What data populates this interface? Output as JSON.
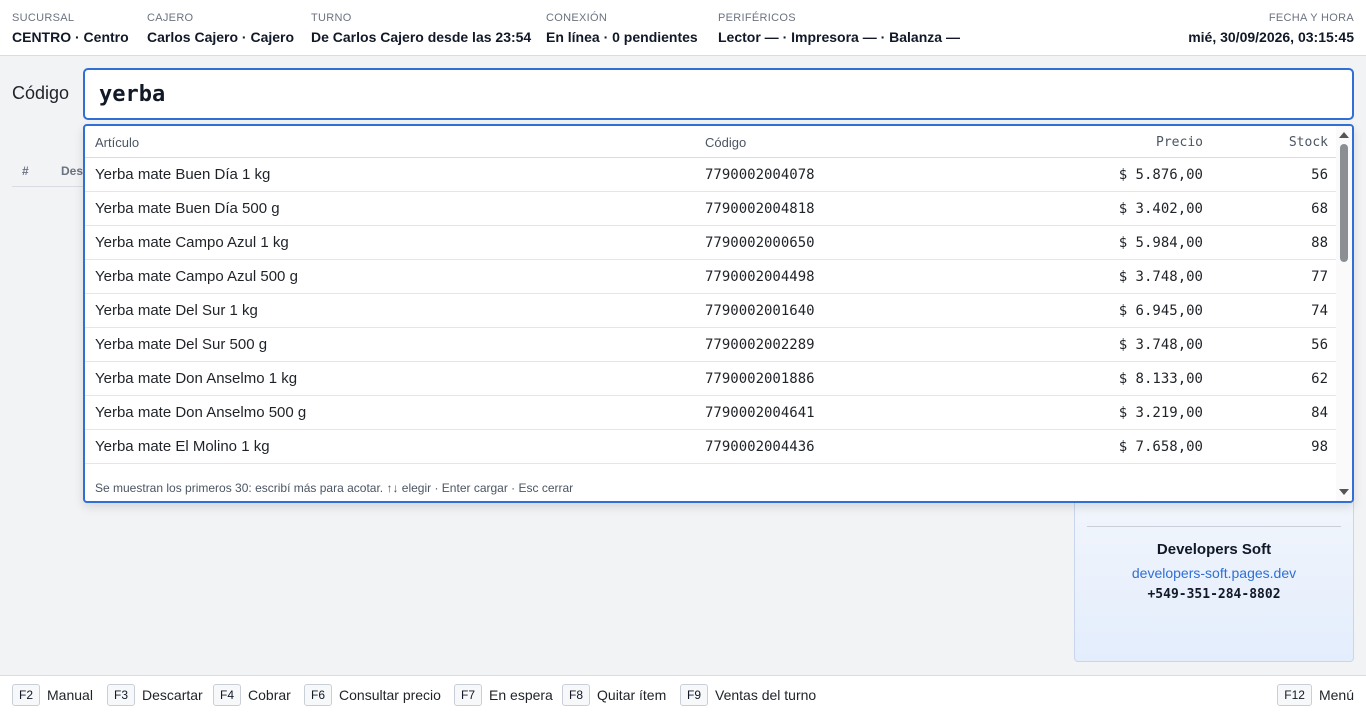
{
  "status_bar": {
    "branch": {
      "label": "SUCURSAL",
      "value": "CENTRO · Centro"
    },
    "cashier": {
      "label": "CAJERO",
      "value": "Carlos Cajero · Cajero"
    },
    "shift": {
      "label": "TURNO",
      "value": "De Carlos Cajero desde las 23:54"
    },
    "connection": {
      "label": "CONEXIÓN",
      "value": "En línea · 0 pendientes"
    },
    "peripherals": {
      "label": "PERIFÉRICOS",
      "value": "Lector — · Impresora — · Balanza —"
    },
    "datetime": {
      "label": "FECHA Y HORA",
      "value": "mié, 30/09/2026, 03:15:45"
    }
  },
  "code_entry": {
    "label": "Código",
    "value": "yerba"
  },
  "cart_table": {
    "col_index": "#",
    "col_desc": "Des"
  },
  "search_results": {
    "headers": {
      "name": "Artículo",
      "code": "Código",
      "price": "Precio",
      "stock": "Stock"
    },
    "rows": [
      {
        "name": "Yerba mate Buen Día 1 kg",
        "code": "7790002004078",
        "price": "$ 5.876,00",
        "stock": "56"
      },
      {
        "name": "Yerba mate Buen Día 500 g",
        "code": "7790002004818",
        "price": "$ 3.402,00",
        "stock": "68"
      },
      {
        "name": "Yerba mate Campo Azul 1 kg",
        "code": "7790002000650",
        "price": "$ 5.984,00",
        "stock": "88"
      },
      {
        "name": "Yerba mate Campo Azul 500 g",
        "code": "7790002004498",
        "price": "$ 3.748,00",
        "stock": "77"
      },
      {
        "name": "Yerba mate Del Sur 1 kg",
        "code": "7790002001640",
        "price": "$ 6.945,00",
        "stock": "74"
      },
      {
        "name": "Yerba mate Del Sur 500 g",
        "code": "7790002002289",
        "price": "$ 3.748,00",
        "stock": "56"
      },
      {
        "name": "Yerba mate Don Anselmo 1 kg",
        "code": "7790002001886",
        "price": "$ 8.133,00",
        "stock": "62"
      },
      {
        "name": "Yerba mate Don Anselmo 500 g",
        "code": "7790002004641",
        "price": "$ 3.219,00",
        "stock": "84"
      },
      {
        "name": "Yerba mate El Molino 1 kg",
        "code": "7790002004436",
        "price": "$ 7.658,00",
        "stock": "98"
      }
    ],
    "footer": "Se muestran los primeros 30: escribí más para acotar. ↑↓ elegir · Enter cargar · Esc cerrar"
  },
  "side_panel": {
    "brand": "Developers Soft",
    "website": "developers-soft.pages.dev",
    "phone": "+549-351-284-8802"
  },
  "function_keys": [
    {
      "key": "F2",
      "label": "Manual"
    },
    {
      "key": "F3",
      "label": "Descartar"
    },
    {
      "key": "F4",
      "label": "Cobrar"
    },
    {
      "key": "F6",
      "label": "Consultar precio"
    },
    {
      "key": "F7",
      "label": "En espera"
    },
    {
      "key": "F8",
      "label": "Quitar ítem"
    },
    {
      "key": "F9",
      "label": "Ventas del turno"
    },
    {
      "key": "F12",
      "label": "Menú"
    }
  ],
  "colors": {
    "accent": "#2f6fd6",
    "background": "#f2f3f5",
    "panel": "#e3edfc"
  }
}
